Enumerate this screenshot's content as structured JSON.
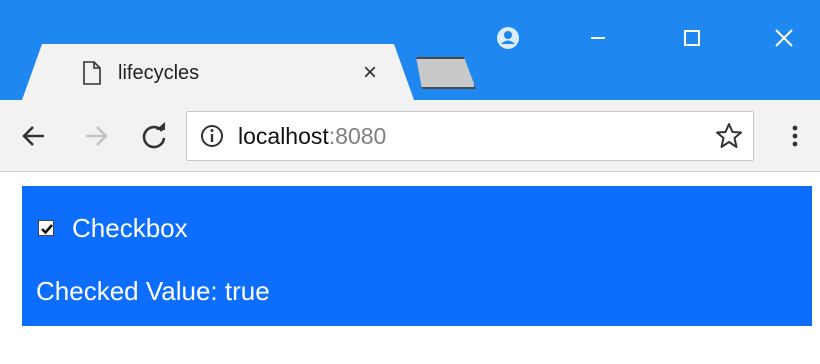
{
  "browser": {
    "tab": {
      "title": "lifecycles",
      "close_glyph": "×",
      "icon": "page-icon"
    },
    "window_controls": [
      "profile-icon",
      "minimize-icon",
      "maximize-icon",
      "close-icon"
    ],
    "address": {
      "host": "localhost",
      "port": ":8080"
    },
    "toolbar_icons": [
      "back-arrow-icon",
      "forward-arrow-icon",
      "reload-icon",
      "info-icon",
      "star-icon",
      "menu-icon"
    ],
    "colors": {
      "titlebar": "#1e87f0",
      "toolbar": "#f2f2f2"
    }
  },
  "page": {
    "checkbox": {
      "label": "Checkbox",
      "checked": true
    },
    "checked_value_text": "Checked Value: true",
    "colors": {
      "panel": "#0d6efd",
      "text": "#ffffff"
    }
  }
}
